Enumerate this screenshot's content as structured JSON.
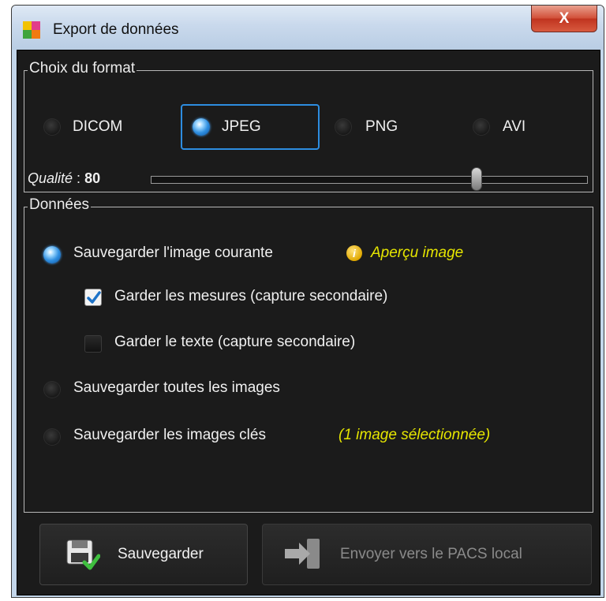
{
  "window": {
    "title": "Export de données",
    "close_label": "X"
  },
  "format_group": {
    "legend": "Choix du format",
    "options": [
      {
        "label": "DICOM",
        "selected": false
      },
      {
        "label": "JPEG",
        "selected": true
      },
      {
        "label": "PNG",
        "selected": false
      },
      {
        "label": "AVI",
        "selected": false
      }
    ],
    "quality_label": "Qualité",
    "quality_sep": " : ",
    "quality_value": "80"
  },
  "data_group": {
    "legend": "Données",
    "current_image": {
      "label": "Sauvegarder l'image courante",
      "selected": true
    },
    "preview_link": "Aperçu image",
    "keep_measures": {
      "label": "Garder les mesures (capture secondaire)",
      "checked": true
    },
    "keep_text": {
      "label": "Garder le texte (capture secondaire)",
      "checked": false
    },
    "all_images": {
      "label": "Sauvegarder toutes les images",
      "selected": false
    },
    "key_images": {
      "label": "Sauvegarder les images clés",
      "selected": false,
      "note": "(1 image sélectionnée)"
    }
  },
  "buttons": {
    "save": "Sauvegarder",
    "send_pacs": "Envoyer vers le PACS local"
  },
  "colors": {
    "accent_yellow": "#e6e600",
    "radio_selected": "#2f8fe0",
    "disabled_text": "#8a8a8a"
  },
  "icons": [
    "app-logo-icon",
    "close-icon",
    "radio-icon",
    "info-icon",
    "checkbox-icon",
    "save-disk-icon",
    "send-arrow-icon"
  ]
}
